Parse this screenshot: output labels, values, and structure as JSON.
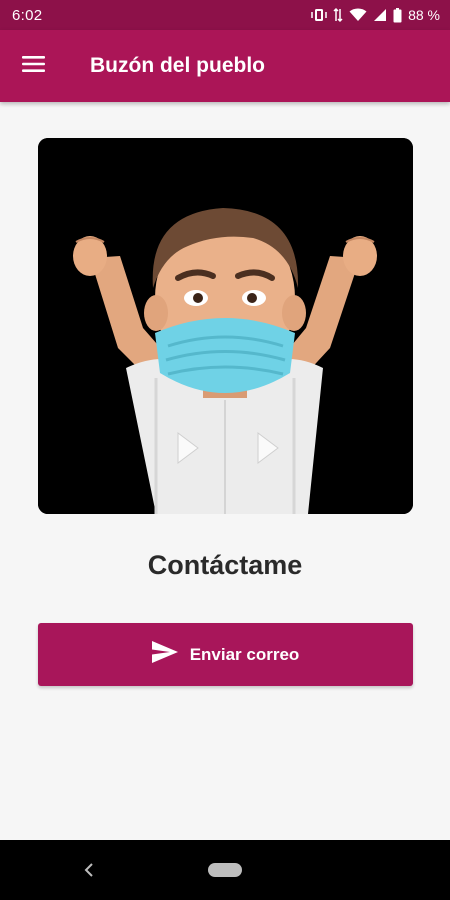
{
  "status_bar": {
    "time": "6:02",
    "battery_percent": "88 %",
    "icons": [
      "vibrate-icon",
      "data-icon",
      "wifi-icon",
      "signal-icon",
      "battery-icon"
    ]
  },
  "app_bar": {
    "title": "Buzón del pueblo",
    "menu_icon": "hamburger-menu-icon"
  },
  "main": {
    "image_description_icon": "avatar-illustration",
    "heading": "Contáctame",
    "send_button_label": "Enviar correo",
    "send_icon": "send-icon"
  },
  "nav_bar": {
    "back_icon": "back-icon",
    "home_icon": "home-pill-icon"
  },
  "colors": {
    "status_bar": "#8d1149",
    "app_bar": "#ab1557",
    "button": "#a8165a",
    "background": "#f6f6f6"
  }
}
